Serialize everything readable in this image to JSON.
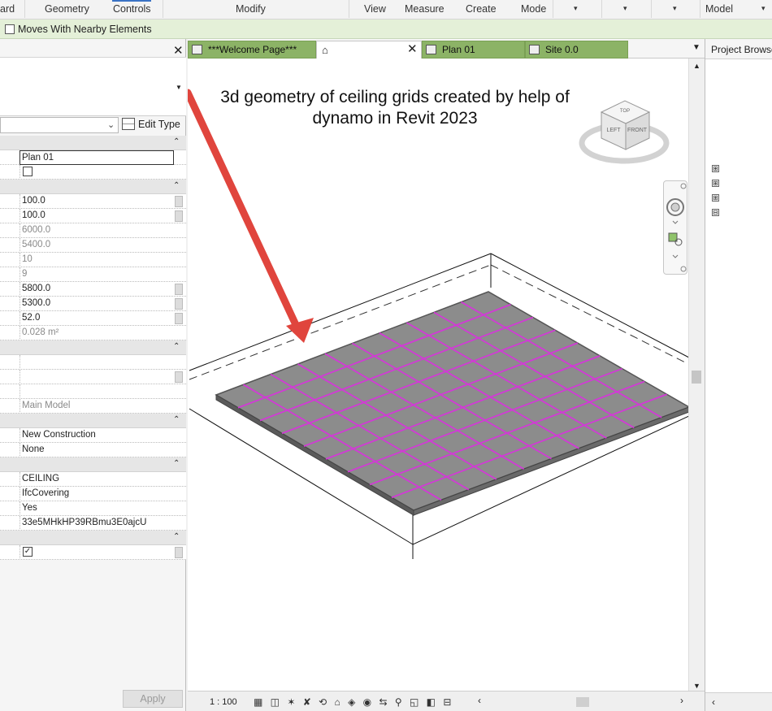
{
  "ribbon": {
    "items": [
      "ard",
      "Geometry",
      "Controls",
      "Modify",
      "View",
      "Measure",
      "Create",
      "Mode",
      "Model"
    ],
    "dropdown_glyph": "▾"
  },
  "options_bar": {
    "moves_with_nearby": {
      "label": "Moves With Nearby Elements",
      "checked": false
    }
  },
  "properties": {
    "close_glyph": "✕",
    "edit_type_label": "Edit Type",
    "apply_label": "Apply",
    "rows": [
      {
        "type": "group"
      },
      {
        "type": "field",
        "value": "Plan 01",
        "boxed": true
      },
      {
        "type": "check",
        "checked": false
      },
      {
        "type": "group"
      },
      {
        "type": "field",
        "value": "100.0",
        "btn": true
      },
      {
        "type": "field",
        "value": "100.0",
        "btn": true
      },
      {
        "type": "field",
        "value": "6000.0",
        "dim": true
      },
      {
        "type": "field",
        "value": "5400.0",
        "dim": true
      },
      {
        "type": "field",
        "value": "10",
        "dim": true
      },
      {
        "type": "field",
        "value": "9",
        "dim": true
      },
      {
        "type": "field",
        "value": "5800.0",
        "btn": true
      },
      {
        "type": "field",
        "value": "5300.0",
        "btn": true
      },
      {
        "type": "field",
        "value": "52.0",
        "btn": true
      },
      {
        "type": "field",
        "value": "0.028 m²",
        "dim": true
      },
      {
        "type": "group"
      },
      {
        "type": "field",
        "value": ""
      },
      {
        "type": "field",
        "value": "",
        "btn": true
      },
      {
        "type": "field",
        "value": ""
      },
      {
        "type": "field",
        "value": "Main Model",
        "dim": true
      },
      {
        "type": "group"
      },
      {
        "type": "field",
        "value": "New Construction"
      },
      {
        "type": "field",
        "value": "None"
      },
      {
        "type": "group"
      },
      {
        "type": "field",
        "value": "CEILING"
      },
      {
        "type": "field",
        "value": "IfcCovering"
      },
      {
        "type": "field",
        "value": "Yes"
      },
      {
        "type": "field",
        "value": "33e5MHkHP39RBmu3E0ajcU"
      },
      {
        "type": "group"
      },
      {
        "type": "check",
        "checked": true,
        "btn": true
      }
    ]
  },
  "tabs": {
    "items": [
      {
        "label": "***Welcome Page***",
        "style": "green"
      },
      {
        "label": "",
        "style": "active",
        "icon": "3d-view-icon"
      },
      {
        "label": "Plan 01",
        "style": "green"
      },
      {
        "label": "Site 0.0",
        "style": "green"
      }
    ],
    "close_glyph": "✕"
  },
  "viewport": {
    "annotation": "3d geometry of ceiling grids created by help of dynamo in Revit 2023",
    "viewcube_faces": [
      "TOP",
      "LEFT",
      "FRONT"
    ],
    "colors": {
      "arrow": "#e0453d",
      "grid": "#d23ad6",
      "ceiling": "#8a8a8a",
      "ceiling_edge": "#555555"
    }
  },
  "view_control_bar": {
    "scale": "1 : 100",
    "icons": "▦ ◫ ✶ ✘ ⟲ ⌂ ◈ ◉ ⇆ ⚲ ◱ ◧ ⊟",
    "left_glyph": "‹",
    "right_glyph": "›"
  },
  "project_browser": {
    "title": "Project Browse",
    "nodes": [
      "⊞",
      "⊞",
      "⊞",
      "⊟"
    ]
  }
}
